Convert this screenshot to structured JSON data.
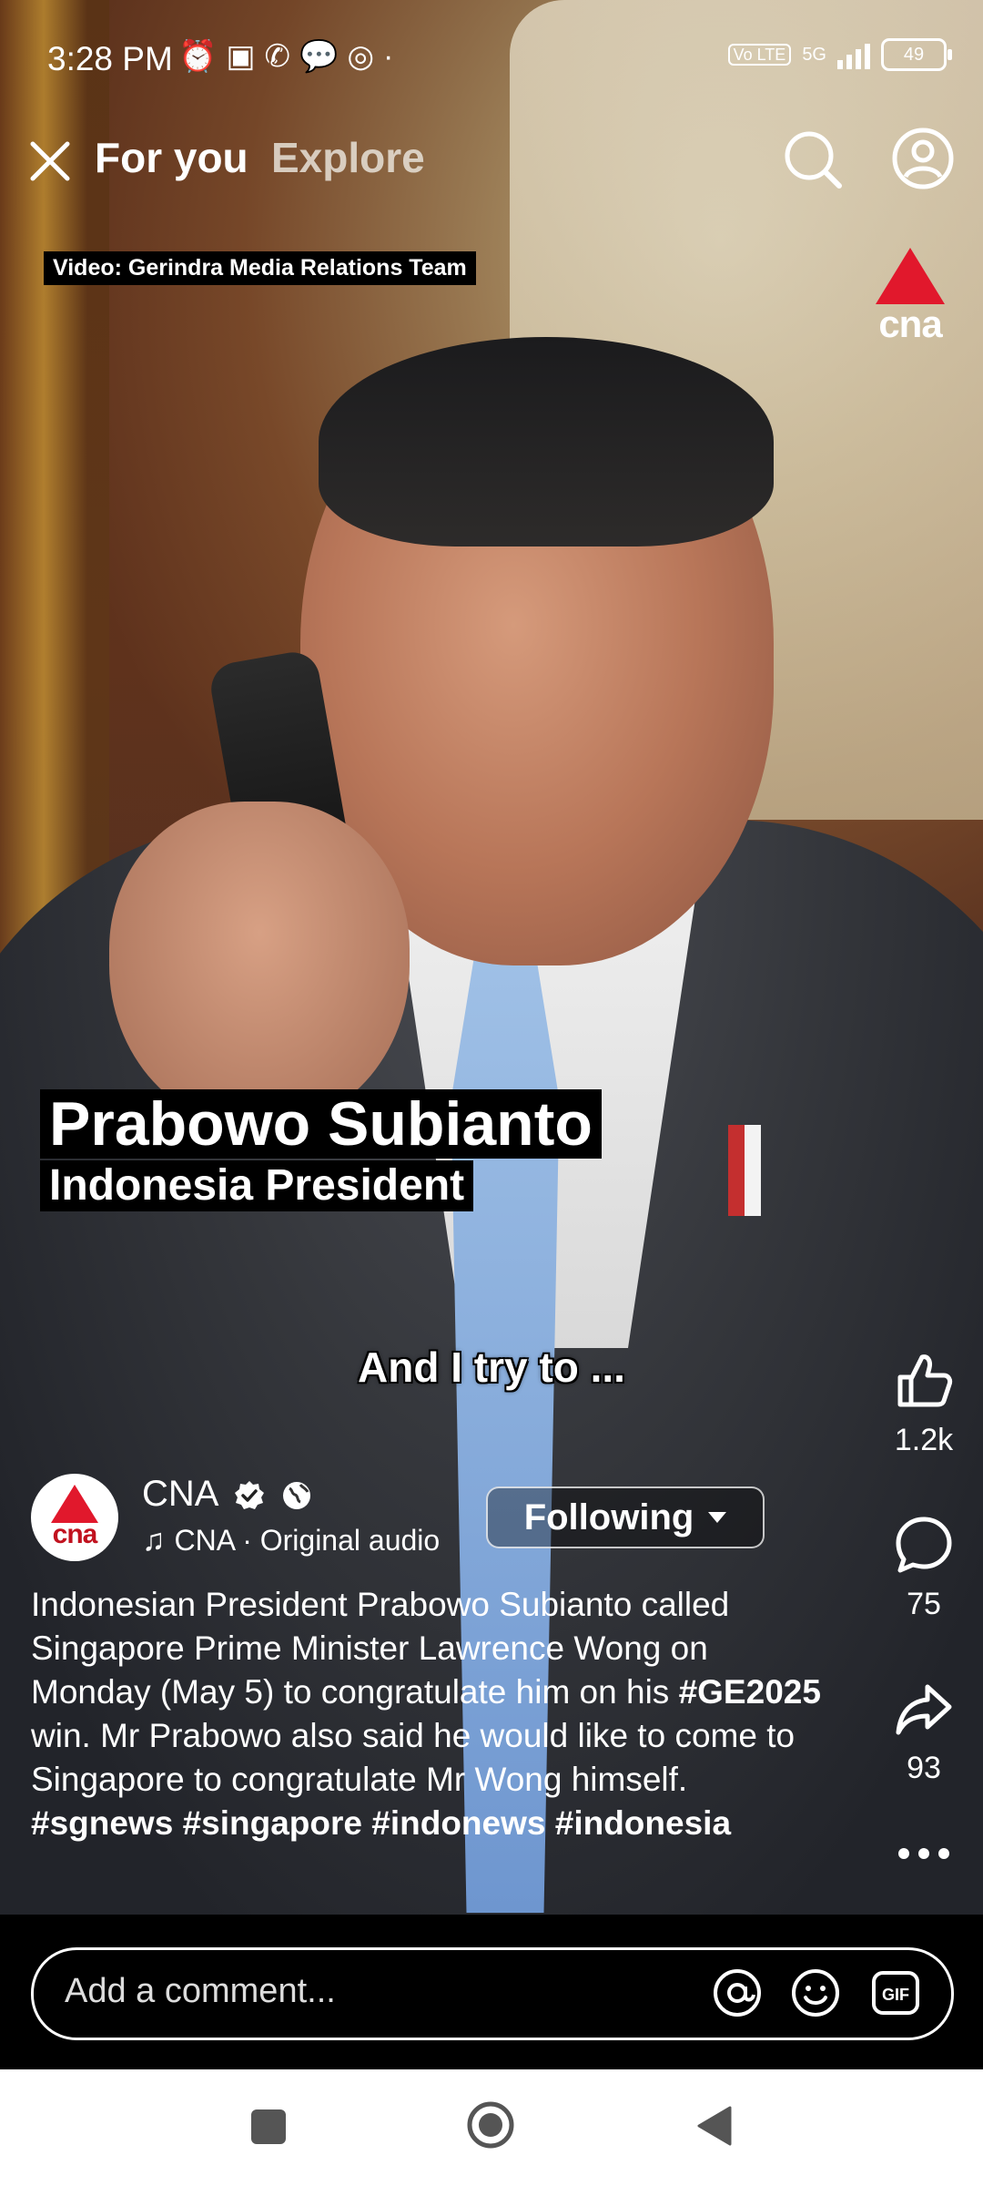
{
  "status_bar": {
    "time": "3:28 PM",
    "network_badge": "Vo LTE",
    "network_type": "5G",
    "battery": "49",
    "left_icons": [
      "alarm-icon",
      "nfc-icon",
      "whatsapp-icon",
      "chat-icon",
      "chrome-icon",
      "dot-icon"
    ]
  },
  "top_nav": {
    "tab_for_you": "For you",
    "tab_explore": "Explore"
  },
  "video": {
    "credit": "Video: Gerindra Media Relations Team",
    "logo_text": "cna",
    "lower_third_name": "Prabowo Subianto",
    "lower_third_title": "Indonesia President",
    "subtitle": "And I try to ..."
  },
  "actions": {
    "likes": "1.2k",
    "comments": "75",
    "shares": "93"
  },
  "author": {
    "name": "CNA",
    "avatar_text": "cna",
    "audio": "CNA · Original audio",
    "follow_label": "Following"
  },
  "caption": {
    "p1": "Indonesian President Prabowo Subianto called Singapore Prime Minister Lawrence Wong on Monday (May 5) to congratulate him on his ",
    "tag1": "#GE2025",
    "p2": " win. Mr Prabowo also said he would like to come to Singapore to congratulate Mr Wong himself. ",
    "tag2": "#sgnews",
    "tag3": "#singapore",
    "tag4": "#indonews",
    "tag5": "#indonesia"
  },
  "comment": {
    "placeholder": "Add a comment..."
  },
  "colors": {
    "accent_red": "#e1182c",
    "background": "#000000",
    "navbar": "#ffffff"
  }
}
